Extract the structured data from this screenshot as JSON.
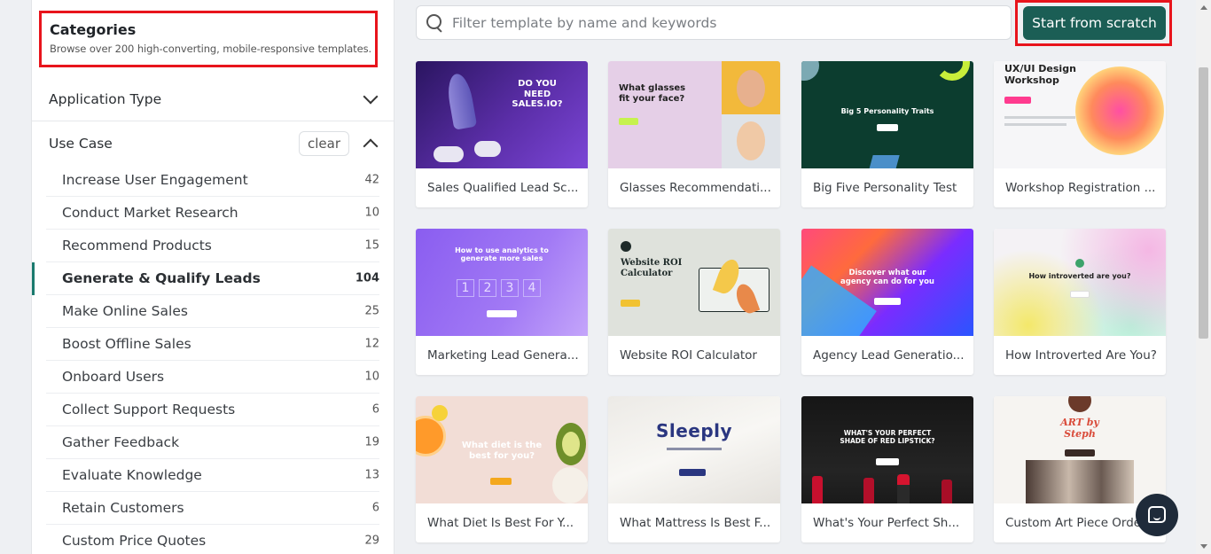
{
  "sidebar": {
    "title": "Categories",
    "subtitle": "Browse over 200 high-converting, mobile-responsive templates.",
    "application_type_label": "Application Type",
    "use_case_label": "Use Case",
    "clear_label": "clear",
    "items": [
      {
        "label": "Increase User Engagement",
        "count": "42"
      },
      {
        "label": "Conduct Market Research",
        "count": "10"
      },
      {
        "label": "Recommend Products",
        "count": "15"
      },
      {
        "label": "Generate & Qualify Leads",
        "count": "104"
      },
      {
        "label": "Make Online Sales",
        "count": "25"
      },
      {
        "label": "Boost Offline Sales",
        "count": "12"
      },
      {
        "label": "Onboard Users",
        "count": "10"
      },
      {
        "label": "Collect Support Requests",
        "count": "6"
      },
      {
        "label": "Gather Feedback",
        "count": "19"
      },
      {
        "label": "Evaluate Knowledge",
        "count": "13"
      },
      {
        "label": "Retain Customers",
        "count": "6"
      },
      {
        "label": "Custom Price Quotes",
        "count": "29"
      }
    ],
    "active_item": "Generate & Qualify Leads"
  },
  "search": {
    "placeholder": "Filter template by name and keywords"
  },
  "scratch_button_label": "Start from scratch",
  "templates": [
    {
      "title": "Sales Qualified Lead Sc...",
      "thumb_text": "DO YOU NEED SALES.IO?"
    },
    {
      "title": "Glasses Recommendati...",
      "thumb_text": "What glasses fit your face?"
    },
    {
      "title": "Big Five Personality Test",
      "thumb_text": "Big 5 Personality Traits"
    },
    {
      "title": "Workshop Registration ...",
      "thumb_text": "UX/UI Design Workshop"
    },
    {
      "title": "Marketing Lead Genera...",
      "thumb_text": "How to use analytics to generate more sales"
    },
    {
      "title": "Website ROI Calculator",
      "thumb_text": "Website ROI Calculator"
    },
    {
      "title": "Agency Lead Generatio...",
      "thumb_text": "Discover what our agency can do for you"
    },
    {
      "title": "How Introverted Are You?",
      "thumb_text": "How introverted are you?"
    },
    {
      "title": "What Diet Is Best For Y...",
      "thumb_text": "What diet is the best for you?"
    },
    {
      "title": "What Mattress Is Best F...",
      "thumb_text": "Sleeply"
    },
    {
      "title": "What's Your Perfect Sh...",
      "thumb_text": "WHAT'S YOUR PERFECT SHADE OF RED LIPSTICK?"
    },
    {
      "title": "Custom Art Piece Orde...",
      "thumb_text": "ART by Steph"
    }
  ],
  "counter_digits": [
    "1",
    "2",
    "3",
    "4"
  ],
  "chat_icon": "chat-bubble-icon",
  "colors": {
    "accent": "#1b5e55",
    "highlight_border": "#e8141c"
  }
}
